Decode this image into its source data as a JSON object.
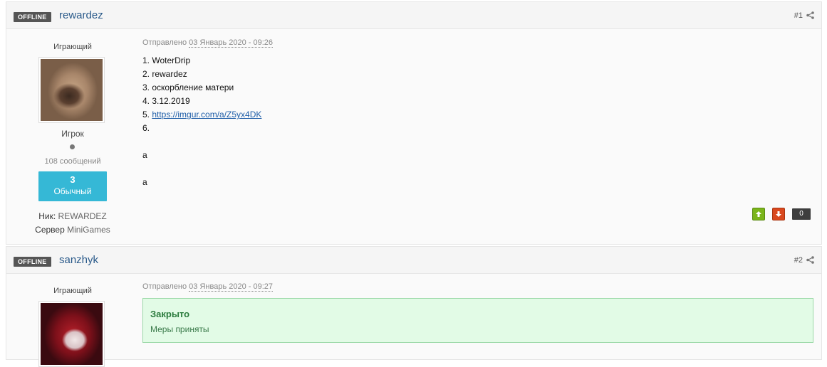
{
  "posts": [
    {
      "status_badge": "OFFLINE",
      "author": "rewardez",
      "number": "#1",
      "rank_title": "Играющий",
      "group": "Игрок",
      "post_count": "108 сообщений",
      "reputation_value": "3",
      "reputation_label": "Обычный",
      "fields": [
        {
          "label": "Ник:",
          "value": "REWARDEZ"
        },
        {
          "label": "Сервер",
          "value": "MiniGames"
        }
      ],
      "date_prefix": "Отправлено",
      "date": "03 Январь 2020 - 09:26",
      "body": {
        "line1": "1. WoterDrip",
        "line2": "2. rewardez",
        "line3": "3. оскорбление матери",
        "line4": "4. 3.12.2019",
        "line5_prefix": "5. ",
        "line5_link": "https://imgur.com/a/Z5yx4DK",
        "line6": "6.",
        "line7": "a",
        "line8": "a"
      },
      "vote_count": "0"
    },
    {
      "status_badge": "OFFLINE",
      "author": "sanzhyk",
      "number": "#2",
      "rank_title": "Играющий",
      "date_prefix": "Отправлено",
      "date": "03 Январь 2020 - 09:27",
      "moderation": {
        "title": "Закрыто",
        "text": "Меры приняты"
      }
    }
  ],
  "icons": {
    "share": "share-icon",
    "vote_up": "arrow-up-icon",
    "vote_down": "arrow-down-icon"
  },
  "colors": {
    "author_link": "#2a5a8a",
    "reputation_bg": "#35b8d6",
    "vote_up": "#7bb51b",
    "vote_down": "#d9481e",
    "moderation_bg": "#e2fbe6"
  }
}
